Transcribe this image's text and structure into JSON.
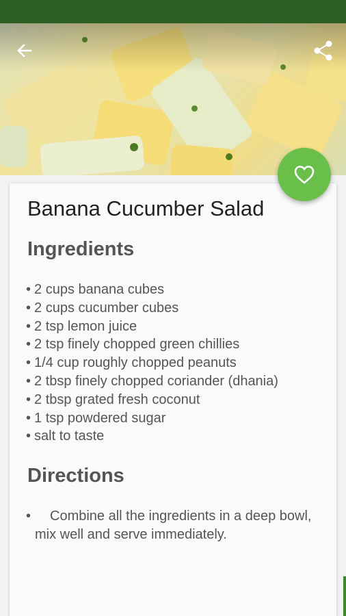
{
  "header": {
    "back_icon": "arrow-left-icon",
    "share_icon": "share-icon"
  },
  "favorite": {
    "icon": "heart-outline-icon",
    "color": "#6abf4b"
  },
  "recipe": {
    "title": "Banana Cucumber Salad",
    "ingredients_heading": "Ingredients",
    "ingredients": [
      "2 cups banana cubes",
      "2 cups cucumber cubes",
      "2 tsp lemon juice",
      "2 tsp finely chopped green chillies",
      "1/4 cup roughly chopped peanuts",
      "2 tbsp finely chopped coriander (dhania)",
      "2 tbsp grated fresh coconut",
      "1 tsp powdered sugar",
      "salt to taste"
    ],
    "directions_heading": "Directions",
    "directions": [
      "Combine all the ingredients in a deep bowl, mix well and serve immediately."
    ]
  },
  "theme": {
    "status_bar": "#2d5f23",
    "accent": "#6abf4b"
  }
}
